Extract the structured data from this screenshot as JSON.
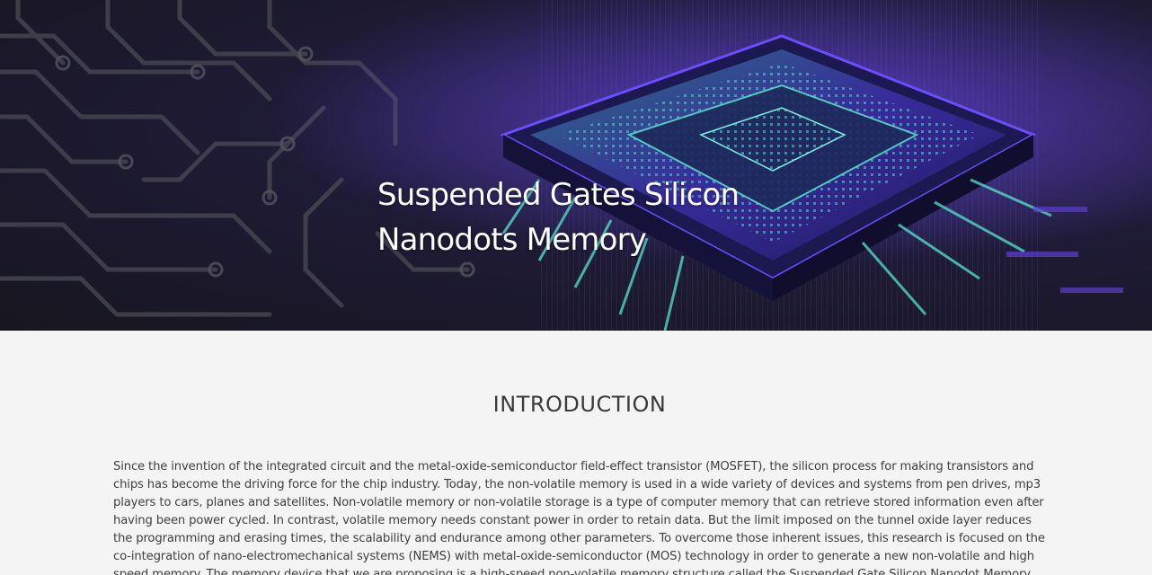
{
  "hero": {
    "title_line1": "Suspended Gates Silicon",
    "title_line2": "Nanodots Memory"
  },
  "introduction": {
    "heading": "INTRODUCTION",
    "paragraph": "Since the invention of the integrated circuit and the metal-oxide-semiconductor field-effect transistor (MOSFET), the silicon process for making transistors and chips has become the driving force for the chip industry. Today, the non-volatile memory is used in a wide variety of devices and systems from pen drives, mp3 players to cars, planes and satellites. Non-volatile memory or non-volatile storage is a type of computer memory that can retrieve stored information even after having been power cycled. In contrast, volatile memory needs constant power in order to retain data. But the limit imposed on the tunnel oxide layer reduces the programming and erasing times, the scalability and endurance among other parameters. To overcome those inherent issues, this research is focused on the co-integration of nano-electromechanical systems (NEMS) with metal-oxide-semiconductor (MOS) technology in order to generate a new non-volatile and high speed memory. The memory device that we are proposing is a high-speed non-volatile memory structure called the Suspended Gate Silicon Nanodot Memory"
  },
  "colors": {
    "hero_bg": "#1f1b36",
    "chip_purple": "#5b3fd1",
    "chip_teal": "#4fd8c4",
    "content_bg": "#f4f4f4"
  }
}
